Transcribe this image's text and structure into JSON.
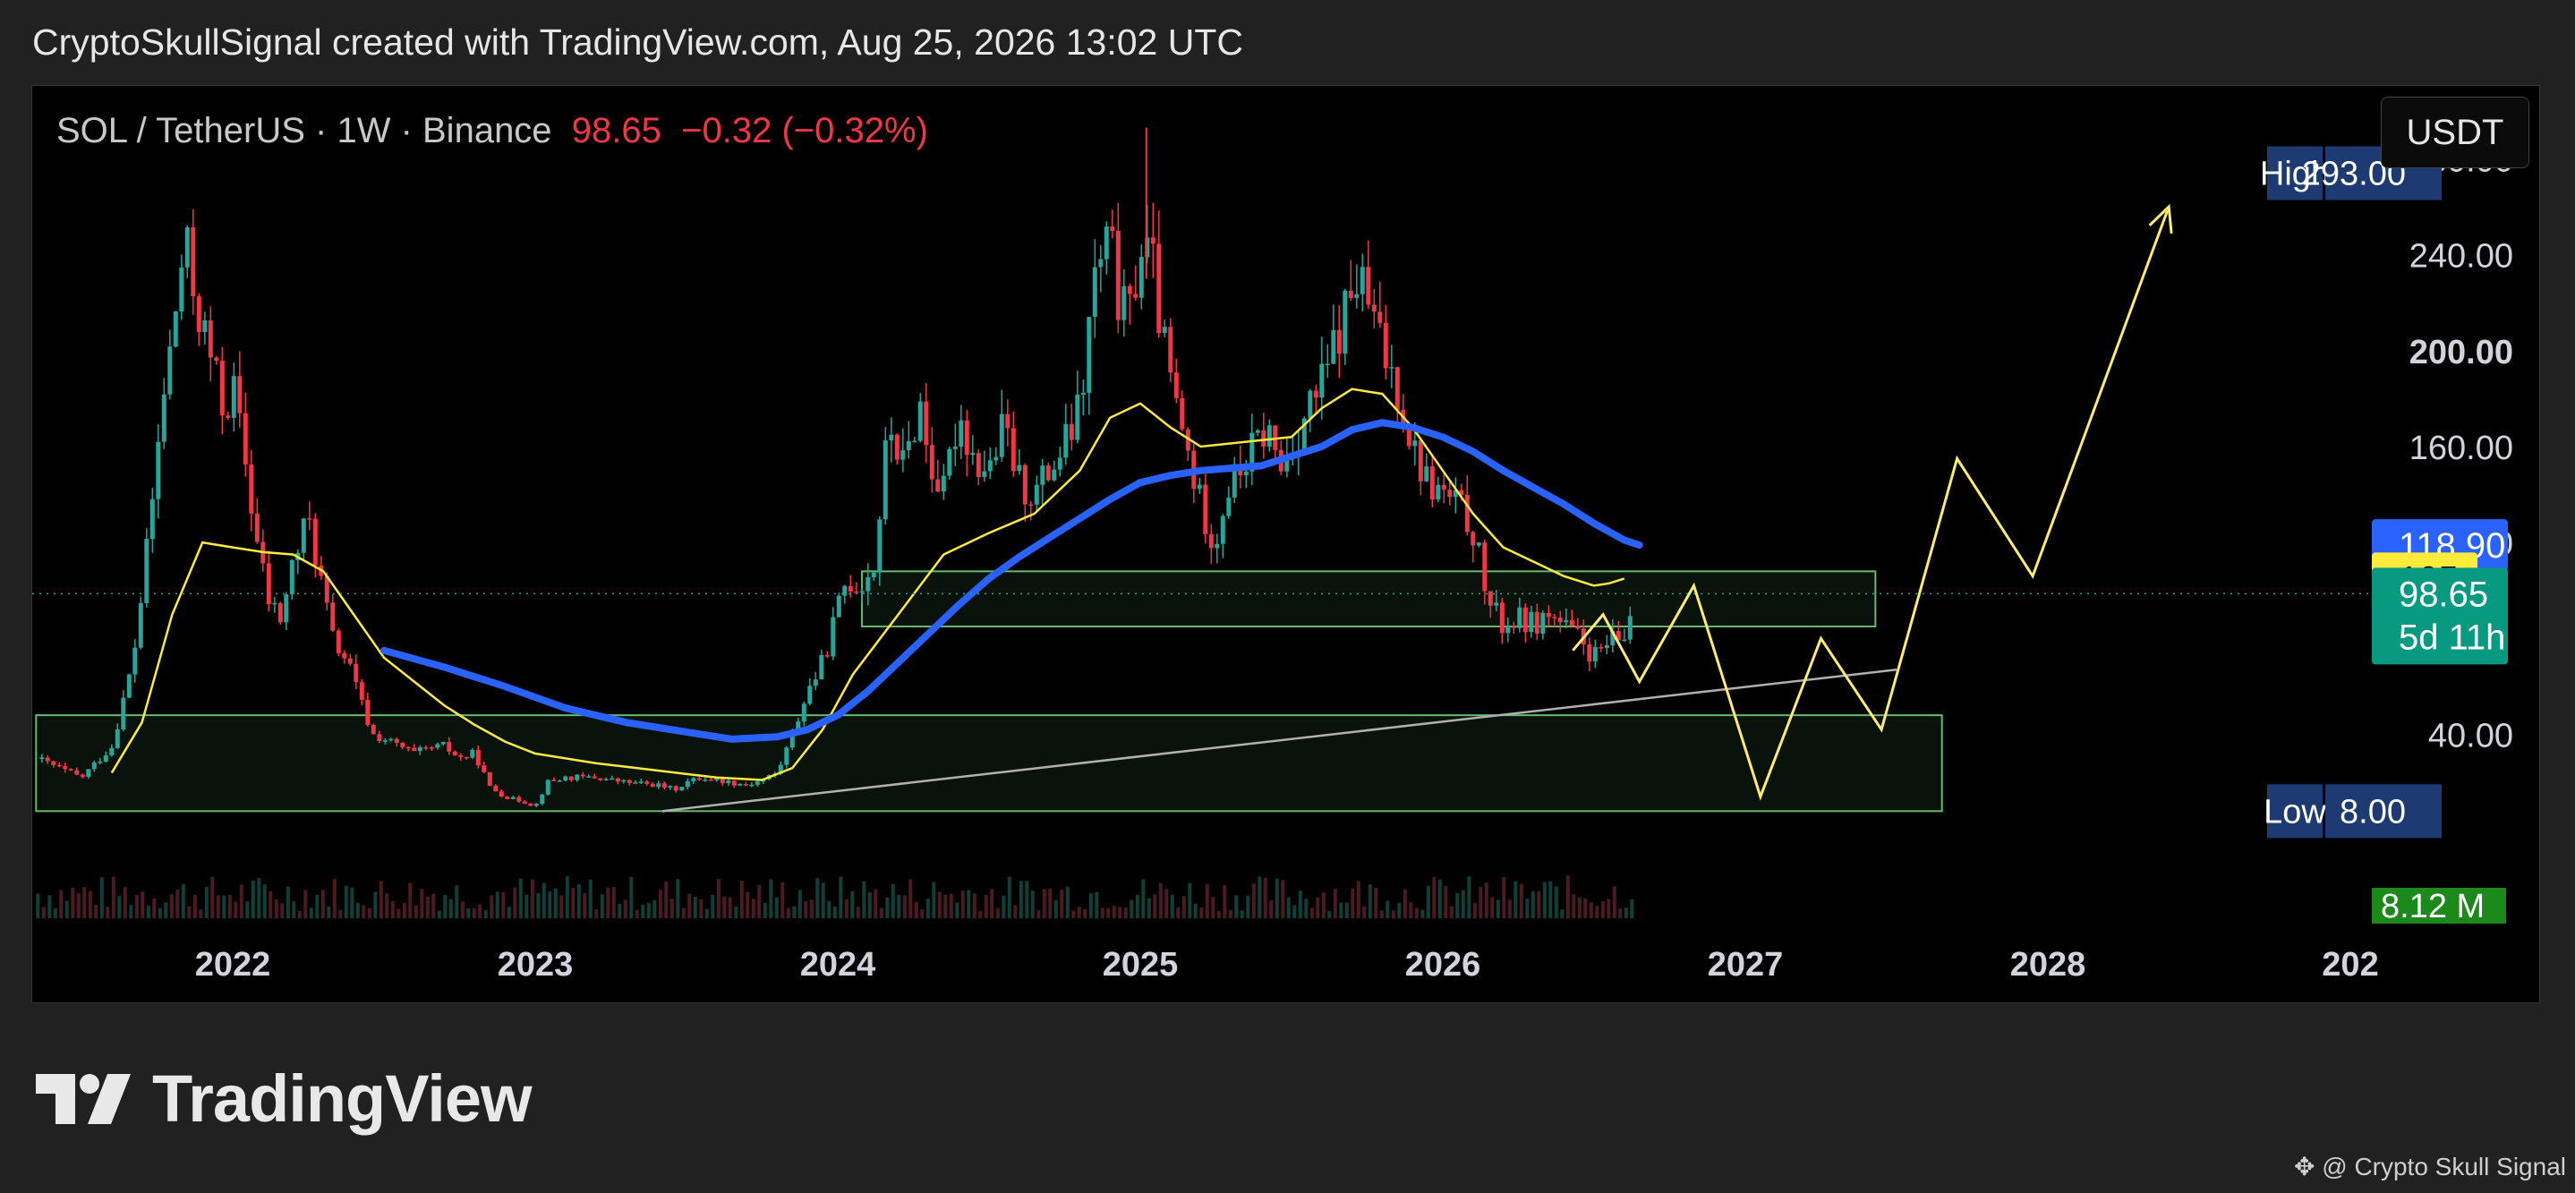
{
  "header": {
    "text": "CryptoSkullSignal created with TradingView.com, Aug 25, 2026 13:02 UTC"
  },
  "legend": {
    "symbol": "SOL / TetherUS · 1W · Binance",
    "price": "98.65",
    "change": "−0.32 (−0.32%)"
  },
  "currency_button": {
    "label": "USDT"
  },
  "footer": {
    "brand": "TradingView",
    "credit": "@ Crypto Skull Signal"
  },
  "colors": {
    "up": "#26a69a",
    "down": "#f23645",
    "ma_fast": "#ffeb3b",
    "ma_slow": "#2962ff",
    "zone": "#66bb6a",
    "projection": "#ffeb70",
    "trendline": "#b0b0b0"
  },
  "chart_data": {
    "type": "candlestick",
    "symbol": "SOL / TetherUS",
    "timeframe": "1W",
    "exchange": "Binance",
    "last_price": 98.65,
    "change": -0.32,
    "change_pct": -0.32,
    "x_ticks": [
      "2022",
      "2023",
      "2024",
      "2025",
      "2026",
      "2027",
      "2028",
      "202"
    ],
    "y_ticks": [
      "40.00",
      "120.00",
      "160.00",
      "200.00",
      "240.00",
      "280.00"
    ],
    "ylim": [
      -18,
      288
    ],
    "price_labels": [
      {
        "name": "High",
        "value": "293.00",
        "color": "#1e3a72"
      },
      {
        "name": "ma_slow",
        "value": "118.90",
        "color": "#2962ff"
      },
      {
        "name": "ma_fast",
        "value": "105",
        "color": "#ffeb3b"
      },
      {
        "name": "last",
        "value": "98.65",
        "sub": "5d 11h",
        "color": "#089981"
      },
      {
        "name": "Low",
        "value": "8.00",
        "color": "#1e3a72"
      },
      {
        "name": "volume",
        "value": "8.12 M",
        "color": "#1b8a1b"
      }
    ],
    "close_path": [
      [
        2021.35,
        30
      ],
      [
        2021.5,
        22
      ],
      [
        2021.6,
        35
      ],
      [
        2021.67,
        70
      ],
      [
        2021.72,
        120
      ],
      [
        2021.77,
        180
      ],
      [
        2021.8,
        205
      ],
      [
        2021.84,
        245
      ],
      [
        2021.87,
        225
      ],
      [
        2021.9,
        210
      ],
      [
        2021.94,
        190
      ],
      [
        2021.97,
        175
      ],
      [
        2022.0,
        185
      ],
      [
        2022.04,
        155
      ],
      [
        2022.08,
        120
      ],
      [
        2022.12,
        95
      ],
      [
        2022.16,
        88
      ],
      [
        2022.2,
        112
      ],
      [
        2022.25,
        130
      ],
      [
        2022.29,
        105
      ],
      [
        2022.33,
        80
      ],
      [
        2022.38,
        70
      ],
      [
        2022.42,
        55
      ],
      [
        2022.46,
        40
      ],
      [
        2022.5,
        38
      ],
      [
        2022.55,
        35
      ],
      [
        2022.6,
        32
      ],
      [
        2022.65,
        34
      ],
      [
        2022.7,
        35
      ],
      [
        2022.75,
        30
      ],
      [
        2022.8,
        32
      ],
      [
        2022.85,
        18
      ],
      [
        2022.9,
        14
      ],
      [
        2022.96,
        12
      ],
      [
        2023.0,
        10
      ],
      [
        2023.04,
        20
      ],
      [
        2023.1,
        22
      ],
      [
        2023.2,
        22
      ],
      [
        2023.3,
        20
      ],
      [
        2023.4,
        19
      ],
      [
        2023.46,
        17
      ],
      [
        2023.5,
        20
      ],
      [
        2023.55,
        22
      ],
      [
        2023.6,
        21
      ],
      [
        2023.65,
        20
      ],
      [
        2023.7,
        19
      ],
      [
        2023.75,
        21
      ],
      [
        2023.8,
        24
      ],
      [
        2023.85,
        40
      ],
      [
        2023.9,
        58
      ],
      [
        2023.95,
        70
      ],
      [
        2024.0,
        92
      ],
      [
        2024.03,
        105
      ],
      [
        2024.07,
        102
      ],
      [
        2024.12,
        110
      ],
      [
        2024.17,
        170
      ],
      [
        2024.22,
        150
      ],
      [
        2024.27,
        180
      ],
      [
        2024.3,
        155
      ],
      [
        2024.35,
        140
      ],
      [
        2024.4,
        175
      ],
      [
        2024.45,
        155
      ],
      [
        2024.5,
        150
      ],
      [
        2024.55,
        168
      ],
      [
        2024.6,
        145
      ],
      [
        2024.65,
        140
      ],
      [
        2024.7,
        150
      ],
      [
        2024.75,
        160
      ],
      [
        2024.8,
        175
      ],
      [
        2024.85,
        230
      ],
      [
        2024.9,
        245
      ],
      [
        2024.93,
        220
      ],
      [
        2024.96,
        210
      ],
      [
        2025.0,
        245
      ],
      [
        2025.04,
        235
      ],
      [
        2025.08,
        200
      ],
      [
        2025.12,
        175
      ],
      [
        2025.17,
        150
      ],
      [
        2025.2,
        135
      ],
      [
        2025.25,
        120
      ],
      [
        2025.28,
        140
      ],
      [
        2025.33,
        150
      ],
      [
        2025.38,
        160
      ],
      [
        2025.42,
        168
      ],
      [
        2025.46,
        150
      ],
      [
        2025.5,
        160
      ],
      [
        2025.55,
        175
      ],
      [
        2025.6,
        185
      ],
      [
        2025.65,
        205
      ],
      [
        2025.7,
        225
      ],
      [
        2025.72,
        230
      ],
      [
        2025.75,
        220
      ],
      [
        2025.8,
        200
      ],
      [
        2025.85,
        185
      ],
      [
        2025.9,
        160
      ],
      [
        2025.95,
        145
      ],
      [
        2026.0,
        140
      ],
      [
        2026.05,
        135
      ],
      [
        2026.1,
        125
      ],
      [
        2026.15,
        95
      ],
      [
        2026.2,
        85
      ],
      [
        2026.25,
        88
      ],
      [
        2026.3,
        86
      ],
      [
        2026.35,
        90
      ],
      [
        2026.4,
        85
      ],
      [
        2026.45,
        80
      ],
      [
        2026.5,
        72
      ],
      [
        2026.55,
        78
      ],
      [
        2026.6,
        80
      ],
      [
        2026.63,
        98.65
      ]
    ],
    "ma_fast": [
      [
        2021.6,
        24
      ],
      [
        2021.7,
        45
      ],
      [
        2021.8,
        90
      ],
      [
        2021.9,
        120
      ],
      [
        2022.0,
        118
      ],
      [
        2022.1,
        116
      ],
      [
        2022.2,
        115
      ],
      [
        2022.3,
        108
      ],
      [
        2022.4,
        90
      ],
      [
        2022.5,
        72
      ],
      [
        2022.6,
        62
      ],
      [
        2022.7,
        52
      ],
      [
        2022.8,
        44
      ],
      [
        2022.9,
        37
      ],
      [
        2023.0,
        32
      ],
      [
        2023.2,
        28
      ],
      [
        2023.4,
        25
      ],
      [
        2023.6,
        22
      ],
      [
        2023.75,
        21
      ],
      [
        2023.85,
        26
      ],
      [
        2023.95,
        42
      ],
      [
        2024.05,
        65
      ],
      [
        2024.2,
        90
      ],
      [
        2024.35,
        115
      ],
      [
        2024.5,
        124
      ],
      [
        2024.65,
        132
      ],
      [
        2024.8,
        150
      ],
      [
        2024.9,
        172
      ],
      [
        2025.0,
        178
      ],
      [
        2025.1,
        168
      ],
      [
        2025.2,
        160
      ],
      [
        2025.35,
        162
      ],
      [
        2025.5,
        164
      ],
      [
        2025.6,
        176
      ],
      [
        2025.7,
        184
      ],
      [
        2025.8,
        182
      ],
      [
        2025.9,
        168
      ],
      [
        2026.0,
        150
      ],
      [
        2026.1,
        132
      ],
      [
        2026.2,
        118
      ],
      [
        2026.3,
        112
      ],
      [
        2026.4,
        106
      ],
      [
        2026.5,
        102
      ],
      [
        2026.55,
        103
      ],
      [
        2026.6,
        105
      ]
    ],
    "ma_slow": [
      [
        2022.5,
        75
      ],
      [
        2022.7,
        68
      ],
      [
        2022.9,
        60
      ],
      [
        2023.1,
        51
      ],
      [
        2023.3,
        45
      ],
      [
        2023.5,
        41
      ],
      [
        2023.65,
        38
      ],
      [
        2023.8,
        39
      ],
      [
        2023.9,
        42
      ],
      [
        2024.0,
        48
      ],
      [
        2024.1,
        58
      ],
      [
        2024.2,
        70
      ],
      [
        2024.3,
        82
      ],
      [
        2024.4,
        94
      ],
      [
        2024.5,
        105
      ],
      [
        2024.6,
        114
      ],
      [
        2024.7,
        122
      ],
      [
        2024.8,
        130
      ],
      [
        2024.9,
        138
      ],
      [
        2025.0,
        145
      ],
      [
        2025.1,
        148
      ],
      [
        2025.2,
        150
      ],
      [
        2025.3,
        151
      ],
      [
        2025.4,
        152
      ],
      [
        2025.5,
        156
      ],
      [
        2025.6,
        160
      ],
      [
        2025.7,
        167
      ],
      [
        2025.8,
        170
      ],
      [
        2025.9,
        168
      ],
      [
        2026.0,
        164
      ],
      [
        2026.1,
        158
      ],
      [
        2026.2,
        150
      ],
      [
        2026.3,
        143
      ],
      [
        2026.4,
        136
      ],
      [
        2026.5,
        128
      ],
      [
        2026.6,
        121
      ],
      [
        2026.65,
        118.9
      ]
    ],
    "zones": [
      {
        "x1": 2024.08,
        "x2": 2027.43,
        "y1": 85,
        "y2": 108
      },
      {
        "x1": 2021.35,
        "x2": 2027.65,
        "y1": 8,
        "y2": 48
      }
    ],
    "trendline": [
      [
        2023.42,
        8
      ],
      [
        2027.5,
        67
      ]
    ],
    "projection": [
      [
        2026.43,
        75
      ],
      [
        2026.53,
        90
      ],
      [
        2026.65,
        62
      ],
      [
        2026.83,
        102
      ],
      [
        2027.05,
        14
      ],
      [
        2027.25,
        80
      ],
      [
        2027.45,
        42
      ],
      [
        2027.7,
        155
      ],
      [
        2027.95,
        106
      ],
      [
        2028.4,
        260
      ]
    ],
    "volume": {
      "last": "8.12 M"
    },
    "high": 293,
    "low": 8
  }
}
